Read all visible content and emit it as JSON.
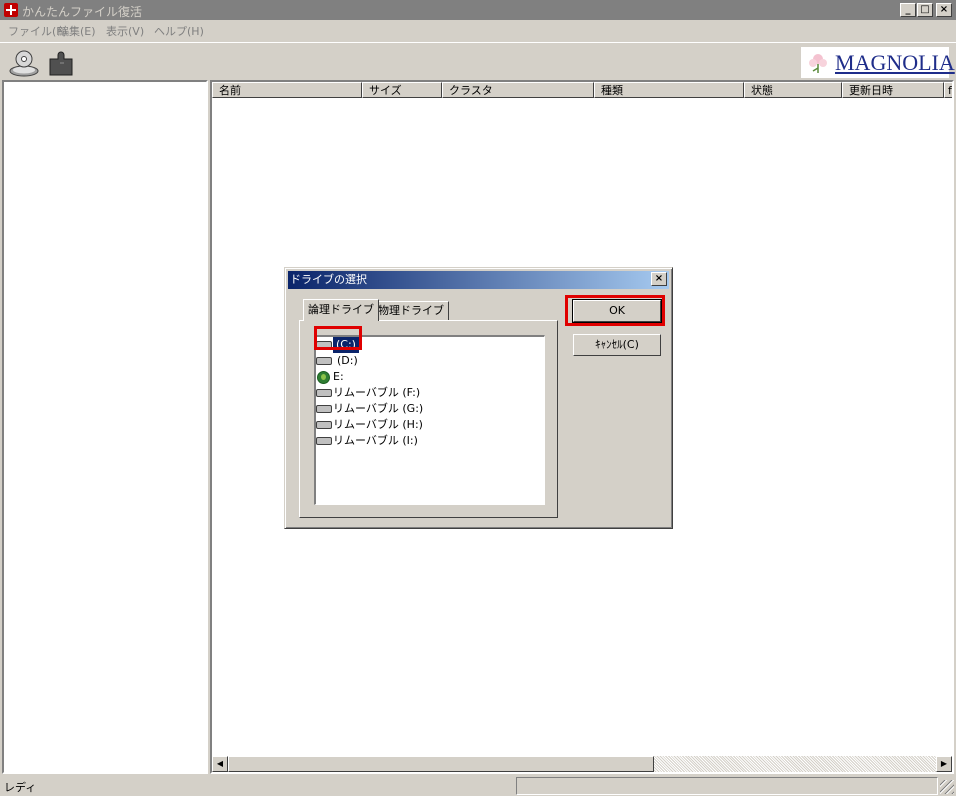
{
  "window": {
    "title": "かんたんファイル復活",
    "minimize": "_",
    "maximize": "□",
    "close": "×"
  },
  "menu": [
    "ファイル(F)",
    "編集(E)",
    "表示(V)",
    "ヘルプ(H)"
  ],
  "toolbar": {
    "icons": [
      "disk-scan-icon",
      "puzzle-icon"
    ]
  },
  "logo": {
    "text": "MAGNOLIA"
  },
  "list": {
    "columns": [
      "名前",
      "サイズ",
      "クラスタ",
      "種類",
      "状態",
      "更新日時",
      "f"
    ]
  },
  "status": {
    "text": "レディ"
  },
  "dialog": {
    "title": "ドライブの選択",
    "close": "×",
    "tabs": [
      "論理ドライブ",
      "物理ドライブ"
    ],
    "drives": [
      {
        "label": "(C:)",
        "icon": "hard-disk-icon",
        "selected": true
      },
      {
        "label": "(D:)",
        "icon": "hard-disk-icon",
        "selected": false
      },
      {
        "label": "E:",
        "icon": "network-drive-icon",
        "selected": false
      },
      {
        "label": "リムーバブル (F:)",
        "icon": "removable-drive-icon",
        "selected": false
      },
      {
        "label": "リムーバブル (G:)",
        "icon": "removable-drive-icon",
        "selected": false
      },
      {
        "label": "リムーバブル (H:)",
        "icon": "removable-drive-icon",
        "selected": false
      },
      {
        "label": "リムーバブル (I:)",
        "icon": "removable-drive-icon",
        "selected": false
      }
    ],
    "ok": "OK",
    "cancel": "ｷｬﾝｾﾙ(C)"
  },
  "colors": {
    "highlight": "#e00000",
    "selection": "#0a246a",
    "title_active": "#0a246a"
  }
}
